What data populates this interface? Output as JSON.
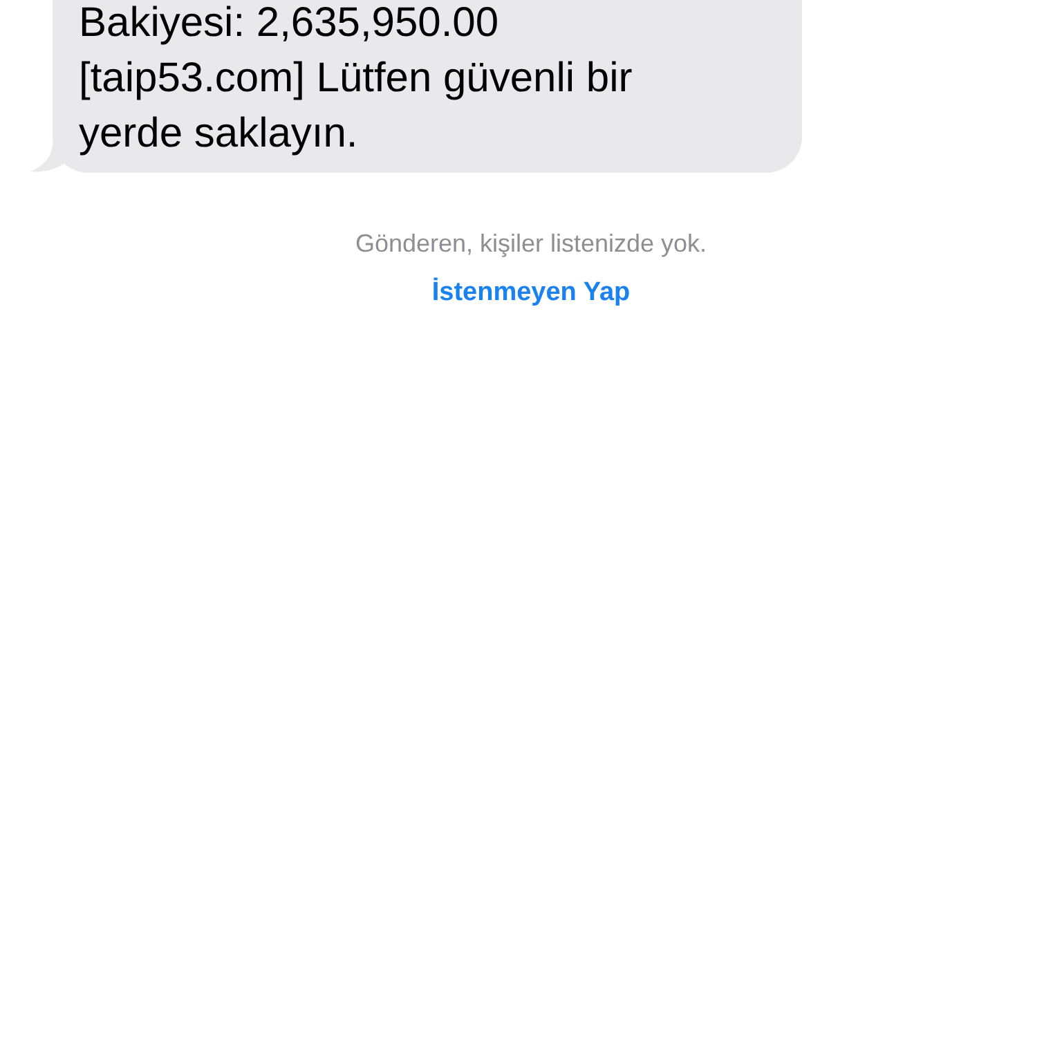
{
  "message": {
    "lines": [
      "Bakiyesi: 2,635,950.00",
      "[taip53.com] Lütfen güvenli bir",
      "yerde saklayın."
    ]
  },
  "notice": {
    "text": "Gönderen, kişiler listenizde yok.",
    "action": "İstenmeyen Yap"
  }
}
